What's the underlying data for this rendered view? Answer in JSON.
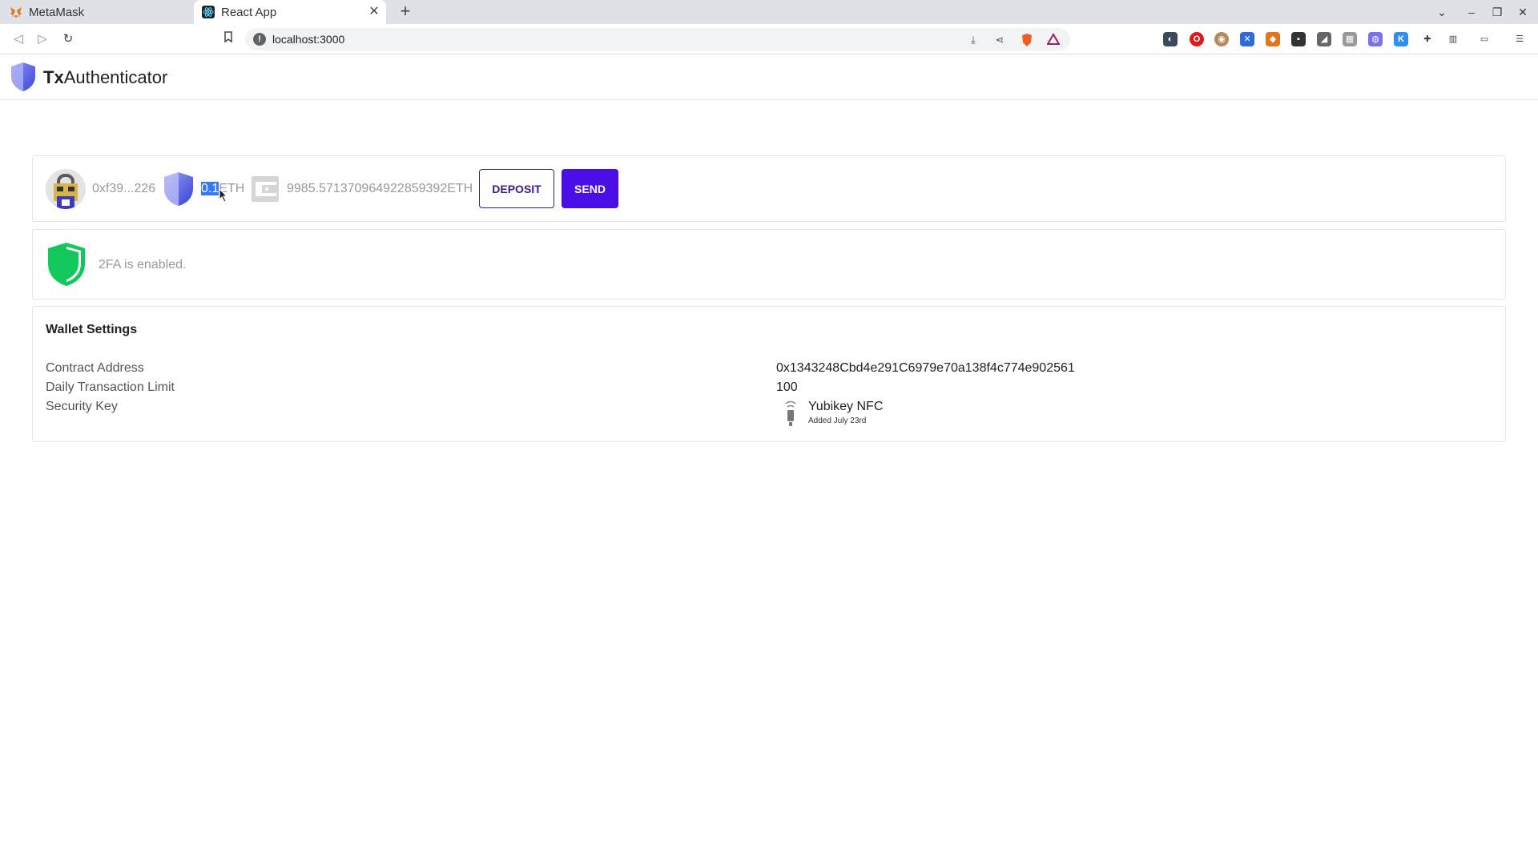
{
  "browser": {
    "tabs": [
      {
        "title": "MetaMask",
        "active": false
      },
      {
        "title": "React App",
        "active": true
      }
    ],
    "url": "localhost:3000",
    "icons": {
      "back": "back-arrow-icon",
      "forward": "forward-arrow-icon",
      "reload": "reload-icon",
      "bookmark": "bookmark-icon",
      "info": "info-icon",
      "install": "install-icon",
      "share": "share-icon",
      "brave": "brave-shield-icon",
      "rewards": "brave-rewards-icon"
    }
  },
  "app": {
    "brand_bold": "Tx",
    "brand_rest": "Authenticator",
    "account": {
      "address": "0xf39...226",
      "limit_selected": "0.1",
      "limit_rest": "ETH",
      "balance": "9985.571370964922859392ETH",
      "deposit_label": "DEPOSIT",
      "send_label": "SEND"
    },
    "twofa": {
      "status_text": "2FA is enabled.",
      "color": "#12c85a"
    },
    "settings": {
      "title": "Wallet Settings",
      "rows": [
        {
          "label": "Contract Address",
          "value": "0x1343248Cbd4e291C6979e70a138f4c774e902561"
        },
        {
          "label": "Daily Transaction Limit",
          "value": "100"
        },
        {
          "label": "Security Key",
          "key_name": "Yubikey NFC",
          "key_added": "Added July 23rd"
        }
      ]
    },
    "colors": {
      "primary": "#4b0ee6",
      "deposit_border": "#3c1a8e",
      "shield_blue": "#5b6cf0"
    }
  }
}
